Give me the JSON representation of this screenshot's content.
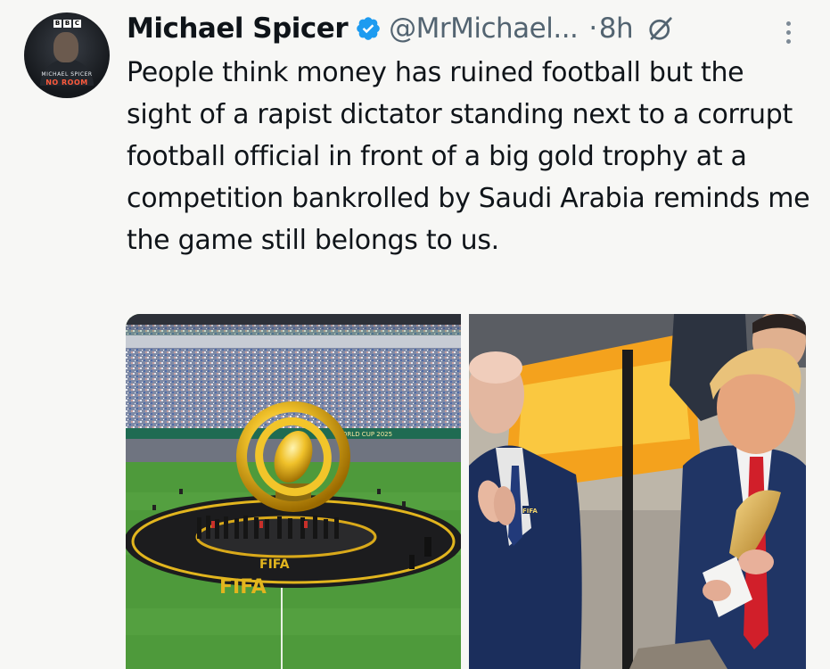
{
  "author": {
    "display_name": "Michael Spicer",
    "handle": "@MrMichael...",
    "separator": "·",
    "time": "8h",
    "avatar": {
      "bbc_letters": [
        "B",
        "B",
        "C"
      ],
      "caption_name": "MICHAEL SPICER",
      "caption_show": "NO ROOM"
    }
  },
  "tweet": {
    "text": "People think money has ruined football but the sight of a rapist dictator standing next to a corrupt football official in front of a big gold trophy at a competition bankrolled by Saudi Arabia reminds me the game still belongs to us."
  },
  "media": {
    "left": {
      "banner_text": "WORLD CUP 2025",
      "ground_text": "FIFA",
      "stage_text": "FIFA"
    },
    "right": {
      "badge_text": "FIFA"
    }
  },
  "colors": {
    "verified": "#1d9bf0",
    "meta": "#536471",
    "text": "#0f1419",
    "background": "#f7f7f5"
  },
  "icons": {
    "verified": "verified-badge-icon",
    "grok": "grok-icon",
    "more": "more-options-icon"
  }
}
